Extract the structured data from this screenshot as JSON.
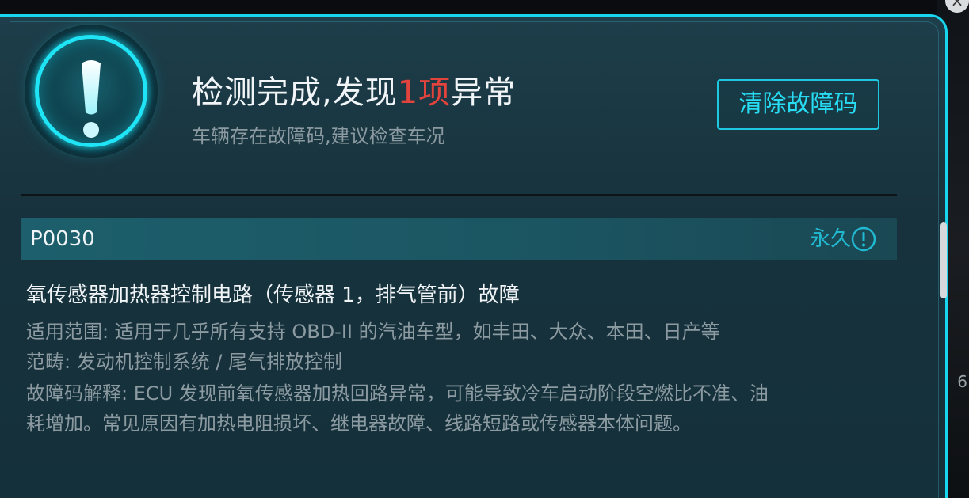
{
  "background": {
    "right_edge_digit": "6",
    "close_glyph": "×"
  },
  "dialog": {
    "title_prefix": "检测完成,发现",
    "title_count": "1项",
    "title_suffix": "异常",
    "subtitle": "车辆存在故障码,建议检查车况",
    "clear_button_label": "清除故障码",
    "accent_color": "#1ee4f6",
    "alert_color": "#e2433d"
  },
  "fault": {
    "code": "P0030",
    "status": "永久",
    "title": "氧传感器加热器控制电路（传感器 1，排气管前）故障",
    "details": [
      "适用范围: 适用于几乎所有支持 OBD-II 的汽油车型，如丰田、大众、本田、日产等",
      "范畴: 发动机控制系统 / 尾气排放控制",
      "故障码解释: ECU 发现前氧传感器加热回路异常，可能导致冷车启动阶段空燃比不准、油",
      "耗增加。常见原因有加热电阻损坏、继电器故障、线路短路或传感器本体问题。"
    ]
  }
}
